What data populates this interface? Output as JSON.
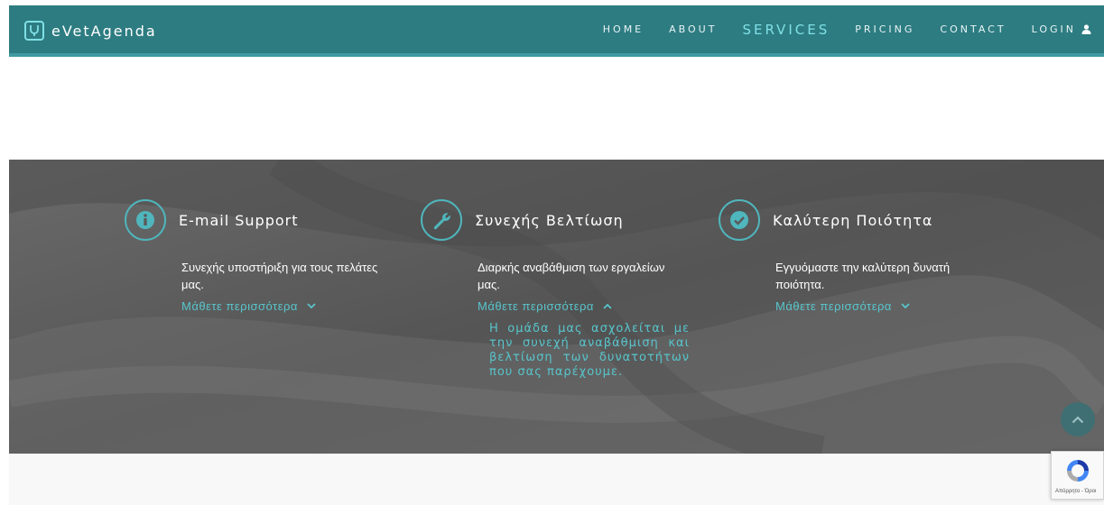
{
  "navbar": {
    "brand": "eVetAgenda",
    "links": [
      "HOME",
      "ABOUT",
      "SERVICES",
      "PRICING",
      "CONTACT",
      "LOGIN"
    ],
    "active": "SERVICES",
    "colors": {
      "bar": "#2d7c81",
      "accent": "#7fe0e6"
    }
  },
  "services": {
    "items": [
      {
        "icon": "info-icon",
        "title": "E-mail Support",
        "description": "Συνεχής υποστήριξη για τους πελάτες μας.",
        "more": "Μάθετε περισσότερα",
        "chevron": "chevron-down-icon"
      },
      {
        "icon": "wrench-icon",
        "title": "Συνεχής Βελτίωση",
        "description": "Διαρκής αναβάθμιση των εργαλείων μας.",
        "more": "Μάθετε περισσότερα",
        "chevron": "chevron-up-icon",
        "expanded_text": "Η ομάδα μας ασχολείται με την συνεχή αναβάθμιση και βελτίωση των δυνατοτήτων που σας παρέχουμε."
      },
      {
        "icon": "check-icon",
        "title": "Καλύτερη Ποιότητα",
        "description": "Εγγυόμαστε την καλύτερη δυνατή ποιότητα.",
        "more": "Μάθετε περισσότερα",
        "chevron": "chevron-down-icon"
      }
    ],
    "colors": {
      "accent": "#58c5cc",
      "background": "#5a5a5a"
    }
  },
  "recaptcha": {
    "text": "Απόρρητο - Όροι"
  }
}
